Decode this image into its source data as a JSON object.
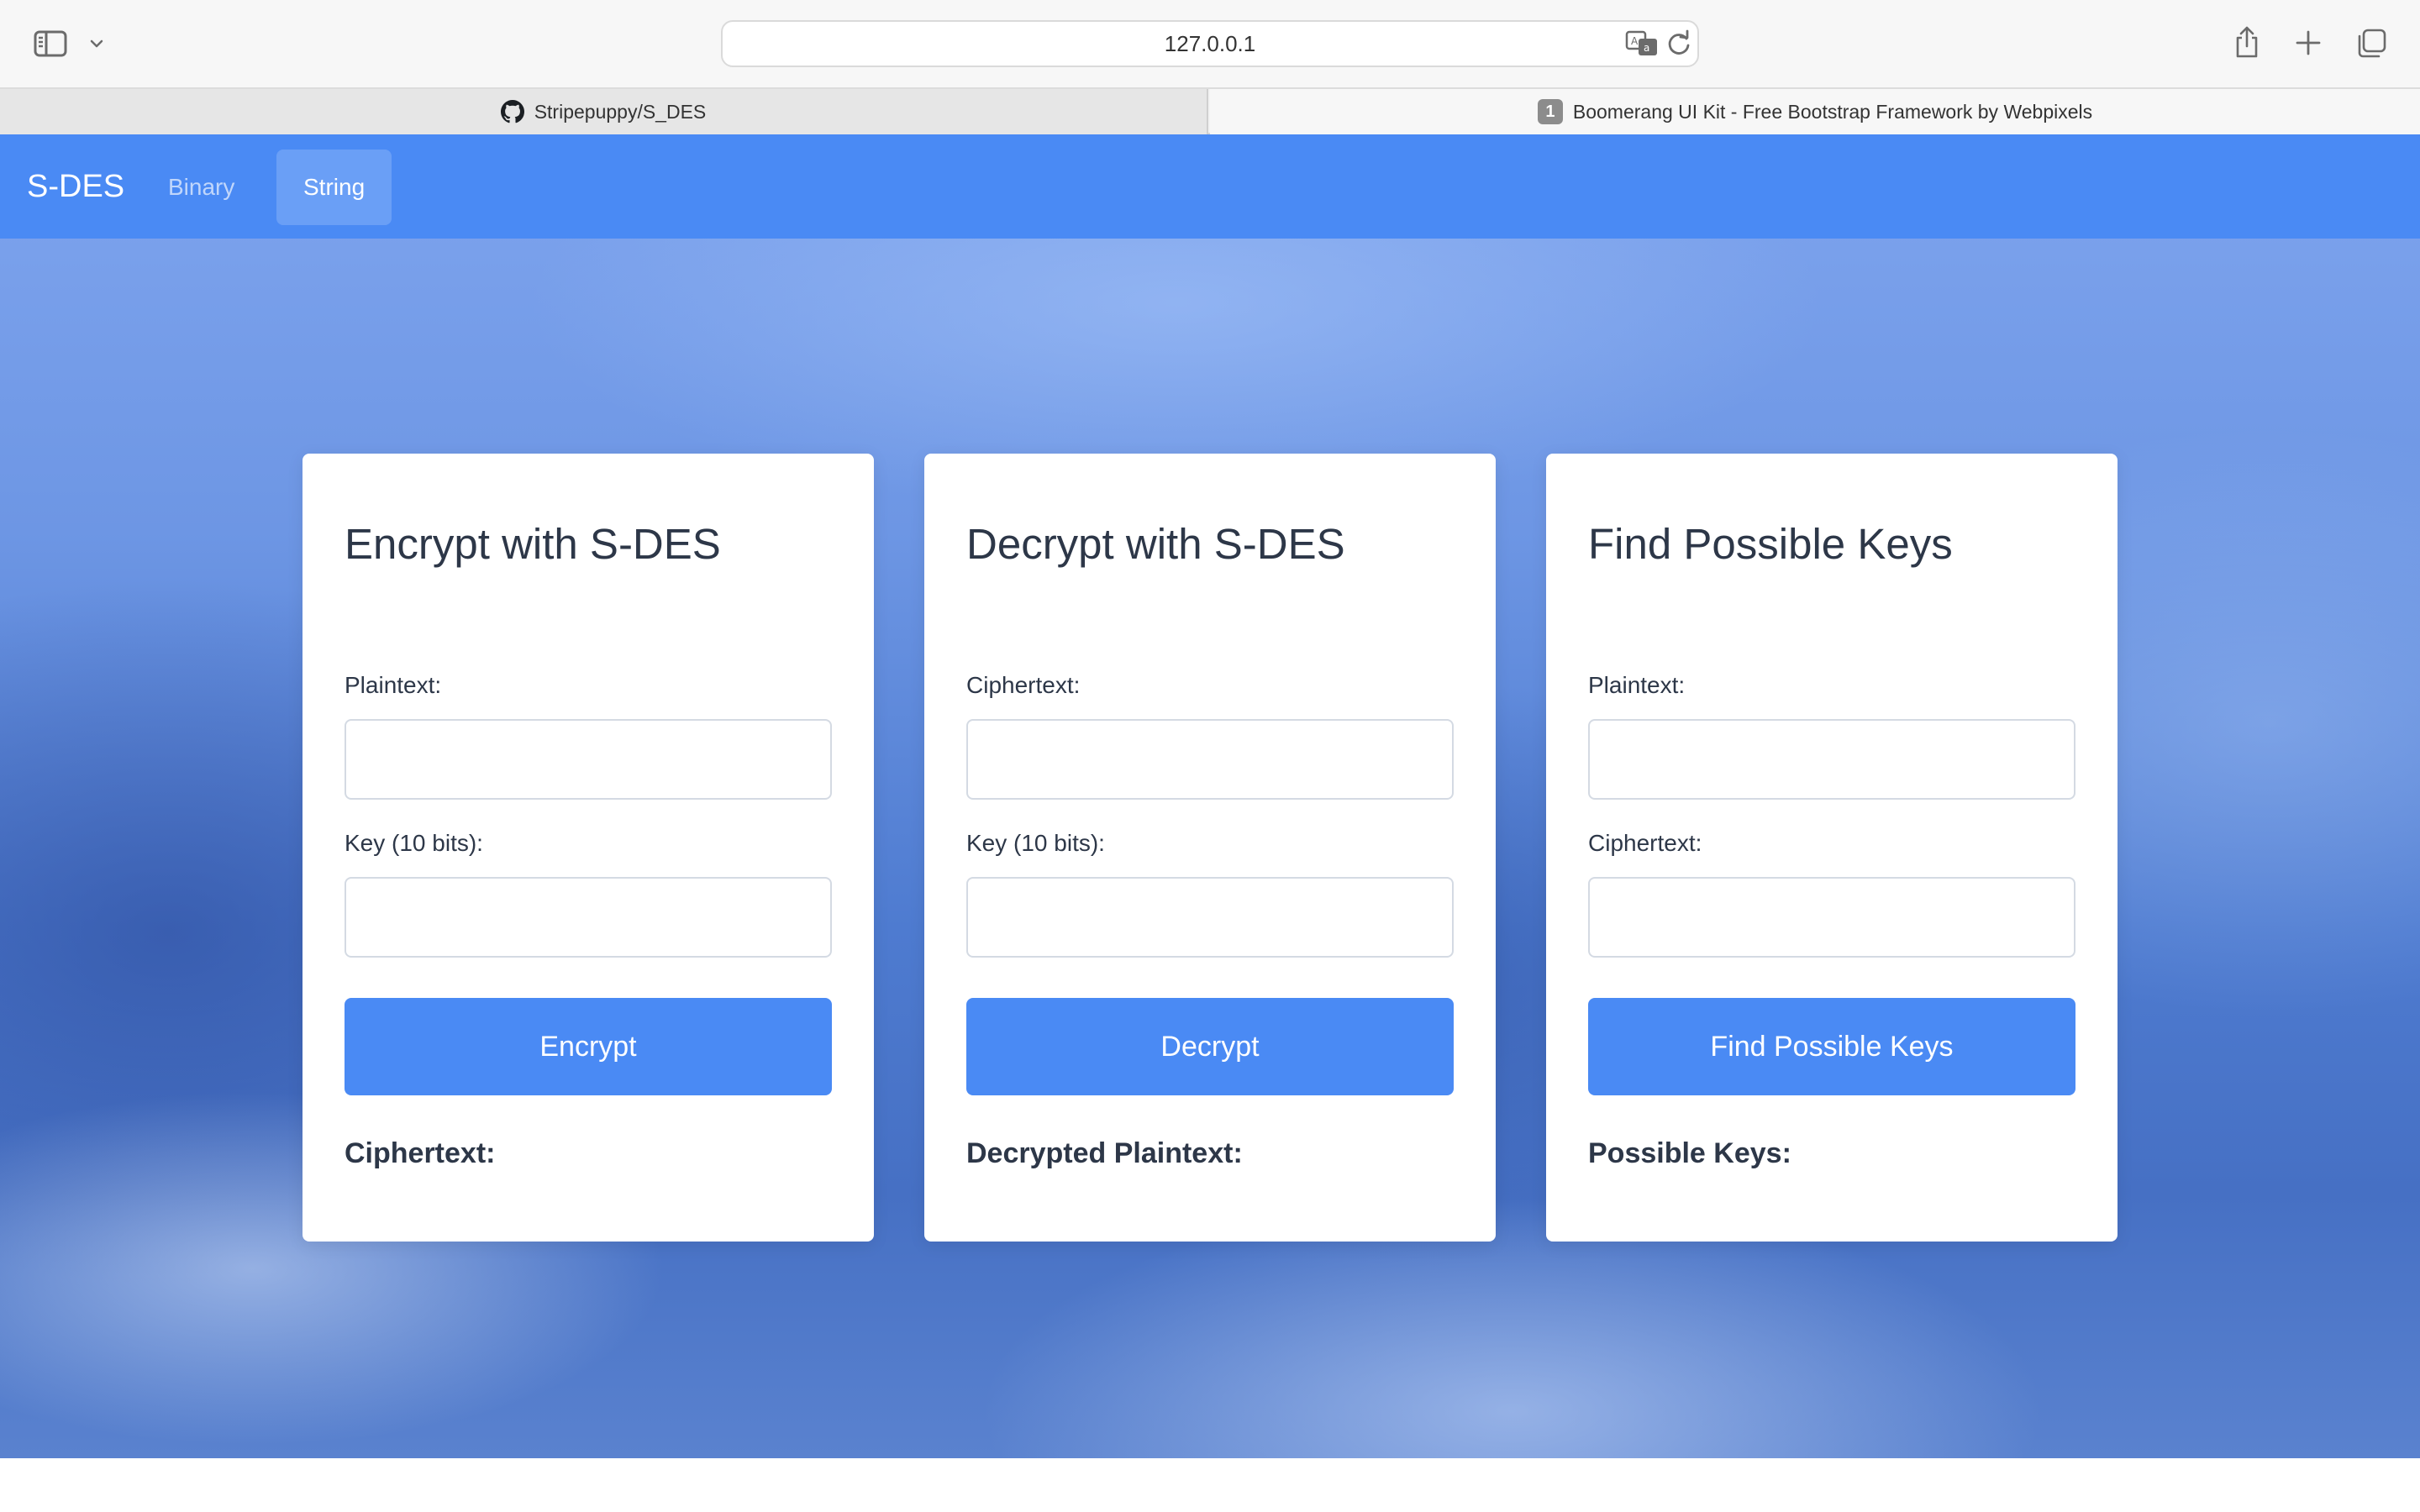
{
  "browser": {
    "url": "127.0.0.1",
    "tabs": [
      {
        "label": "Stripepuppy/S_DES",
        "icon": "github-icon"
      },
      {
        "label": "Boomerang UI Kit - Free Bootstrap Framework by Webpixels",
        "badge": "1"
      }
    ],
    "toolbar_icons": [
      "sidebar-icon",
      "chevron-down-icon",
      "translate-icon",
      "reload-icon",
      "share-icon",
      "plus-icon",
      "tabs-overview-icon"
    ]
  },
  "nav": {
    "brand": "S-DES",
    "links": [
      {
        "label": "Binary",
        "active": false
      },
      {
        "label": "String",
        "active": true
      }
    ]
  },
  "cards": [
    {
      "title": "Encrypt with S-DES",
      "field1_label": "Plaintext:",
      "field1_value": "",
      "field2_label": "Key (10 bits):",
      "field2_value": "",
      "button": "Encrypt",
      "result_label": "Ciphertext:"
    },
    {
      "title": "Decrypt with S-DES",
      "field1_label": "Ciphertext:",
      "field1_value": "",
      "field2_label": "Key (10 bits):",
      "field2_value": "",
      "button": "Decrypt",
      "result_label": "Decrypted Plaintext:"
    },
    {
      "title": "Find Possible Keys",
      "field1_label": "Plaintext:",
      "field1_value": "",
      "field2_label": "Ciphertext:",
      "field2_value": "",
      "button": "Find Possible Keys",
      "result_label": "Possible Keys:"
    }
  ],
  "colors": {
    "primary": "#4a8af4",
    "navbar": "#4a8af4",
    "card_text": "#2d3748",
    "background_blue": "#5a86d8"
  }
}
